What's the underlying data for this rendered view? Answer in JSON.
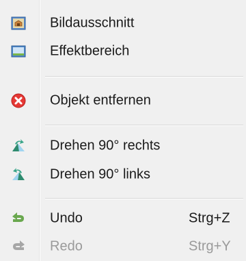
{
  "menu": {
    "items": [
      {
        "label": "Bildausschnitt",
        "icon": "image-crop-icon"
      },
      {
        "label": "Effektbereich",
        "icon": "effect-area-icon"
      },
      {
        "label": "Objekt entfernen",
        "icon": "remove-object-icon"
      },
      {
        "label": "Drehen 90° rechts",
        "icon": "rotate-right-icon"
      },
      {
        "label": "Drehen 90° links",
        "icon": "rotate-left-icon"
      },
      {
        "label": "Undo",
        "shortcut": "Strg+Z",
        "icon": "undo-icon"
      },
      {
        "label": "Redo",
        "shortcut": "Strg+Y",
        "icon": "redo-icon",
        "disabled": true
      }
    ]
  },
  "colors": {
    "menu_background": "#f0f0f0",
    "text": "#1a1a1a",
    "disabled_text": "#9a9a9a",
    "remove_icon": "#e53935",
    "undo_icon": "#6aa84f",
    "redo_icon": "#a6a6a6",
    "rotate_icon": "#3a9a8a"
  }
}
